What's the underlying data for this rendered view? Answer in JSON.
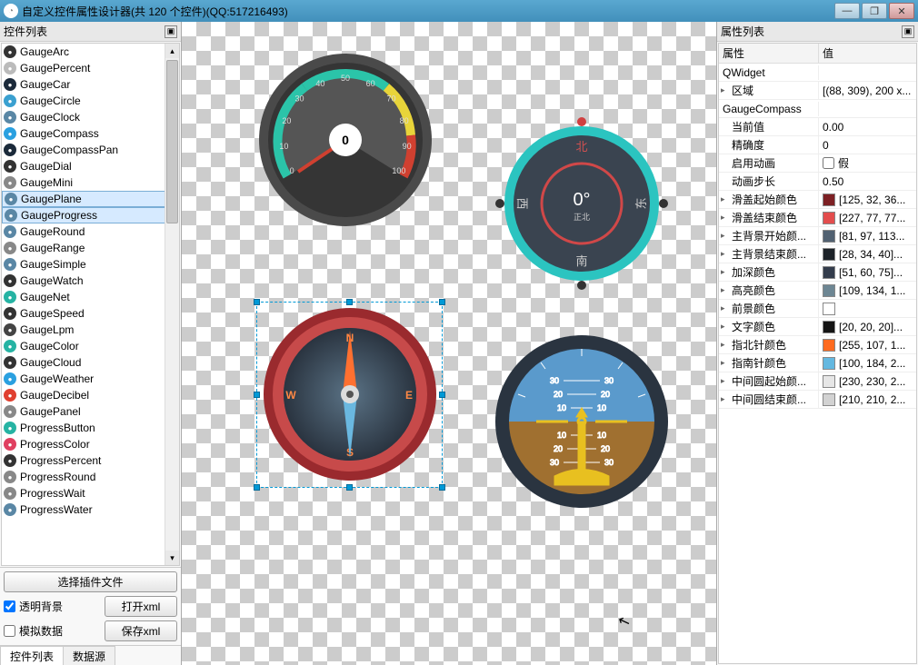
{
  "title": "自定义控件属性设计器(共 120 个控件)(QQ:517216493)",
  "winbtns": {
    "min": "—",
    "max": "❐",
    "close": "✕"
  },
  "left": {
    "header": "控件列表",
    "select_plugin": "选择插件文件",
    "transparent_bg": "透明背景",
    "open_xml": "打开xml",
    "mock_data": "模拟数据",
    "save_xml": "保存xml",
    "tab_widgets": "控件列表",
    "tab_data": "数据源",
    "items": [
      {
        "label": "GaugeArc",
        "col": "#333"
      },
      {
        "label": "GaugePercent",
        "col": "#bbb"
      },
      {
        "label": "GaugeCar",
        "col": "#1b2a3a"
      },
      {
        "label": "GaugeCircle",
        "col": "#3aa0d0"
      },
      {
        "label": "GaugeClock",
        "col": "#5a87a5"
      },
      {
        "label": "GaugeCompass",
        "col": "#2aa0e0"
      },
      {
        "label": "GaugeCompassPan",
        "col": "#1b2a3a"
      },
      {
        "label": "GaugeDial",
        "col": "#333"
      },
      {
        "label": "GaugeMini",
        "col": "#888"
      },
      {
        "label": "GaugePlane",
        "col": "#5a87a5",
        "sel": true
      },
      {
        "label": "GaugeProgress",
        "col": "#5a87a5",
        "sel": true
      },
      {
        "label": "GaugeRound",
        "col": "#5a87a5"
      },
      {
        "label": "GaugeRange",
        "col": "#888"
      },
      {
        "label": "GaugeSimple",
        "col": "#5a87a5"
      },
      {
        "label": "GaugeWatch",
        "col": "#333"
      },
      {
        "label": "GaugeNet",
        "col": "#26b3a3"
      },
      {
        "label": "GaugeSpeed",
        "col": "#333"
      },
      {
        "label": "GaugeLpm",
        "col": "#444"
      },
      {
        "label": "GaugeColor",
        "col": "#26b3a3"
      },
      {
        "label": "GaugeCloud",
        "col": "#333"
      },
      {
        "label": "GaugeWeather",
        "col": "#2aa0e0"
      },
      {
        "label": "GaugeDecibel",
        "col": "#e04030"
      },
      {
        "label": "GaugePanel",
        "col": "#888"
      },
      {
        "label": "ProgressButton",
        "col": "#26b3a3"
      },
      {
        "label": "ProgressColor",
        "col": "#e04060"
      },
      {
        "label": "ProgressPercent",
        "col": "#333"
      },
      {
        "label": "ProgressRound",
        "col": "#888"
      },
      {
        "label": "ProgressWait",
        "col": "#888"
      },
      {
        "label": "ProgressWater",
        "col": "#5a87a5"
      }
    ]
  },
  "right": {
    "header": "属性列表",
    "col1": "属性",
    "col2": "值",
    "group1": "QWidget",
    "region_k": "区域",
    "region_v": "[(88, 309), 200 x...",
    "group2": "GaugeCompass",
    "curval_k": "当前值",
    "curval_v": "0.00",
    "prec_k": "精确度",
    "prec_v": "0",
    "anim_k": "启用动画",
    "anim_v": "假",
    "step_k": "动画步长",
    "step_v": "0.50",
    "cover_start_k": "滑盖起始颜色",
    "cover_start_c": "#7d2024",
    "cover_start_v": "[125, 32, 36...",
    "cover_end_k": "滑盖结束颜色",
    "cover_end_c": "#e34d4d",
    "cover_end_v": "[227, 77, 77...",
    "bg_start_k": "主背景开始颜...",
    "bg_start_c": "#516171",
    "bg_start_v": "[81, 97, 113...",
    "bg_end_k": "主背景结束颜...",
    "bg_end_c": "#1c2228",
    "bg_end_v": "[28, 34, 40]...",
    "dark_k": "加深颜色",
    "dark_c": "#333c4b",
    "dark_v": "[51, 60, 75]...",
    "hl_k": "高亮颜色",
    "hl_c": "#6d8693",
    "hl_v": "[109, 134, 1...",
    "fg_k": "前景颜色",
    "fg_c": "#ffffff",
    "fg_v": "",
    "text_k": "文字颜色",
    "text_c": "#141414",
    "text_v": "[20, 20, 20]...",
    "north_k": "指北针颜色",
    "north_c": "#ff6b1f",
    "north_v": "[255, 107, 1...",
    "south_k": "指南针颜色",
    "south_c": "#64b8e0",
    "south_v": "[100, 184, 2...",
    "center_start_k": "中间圆起始颜...",
    "center_start_c": "#e6e6e6",
    "center_start_v": "[230, 230, 2...",
    "center_end_k": "中间圆结束颜...",
    "center_end_c": "#d2d2d2",
    "center_end_v": "[210, 210, 2..."
  },
  "canvas": {
    "speedo": {
      "val": "0",
      "ticks": [
        "0",
        "10",
        "20",
        "30",
        "40",
        "50",
        "60",
        "70",
        "80",
        "90",
        "100"
      ]
    },
    "compass_dir": {
      "val": "0°",
      "sub": "正北",
      "n": "北",
      "s": "南",
      "e": "东",
      "w": "西"
    },
    "compass_nesw": {
      "n": "N",
      "s": "S",
      "e": "E",
      "w": "W"
    },
    "attitude": {
      "labels": [
        "30",
        "20",
        "10",
        "10",
        "20",
        "30"
      ]
    }
  }
}
